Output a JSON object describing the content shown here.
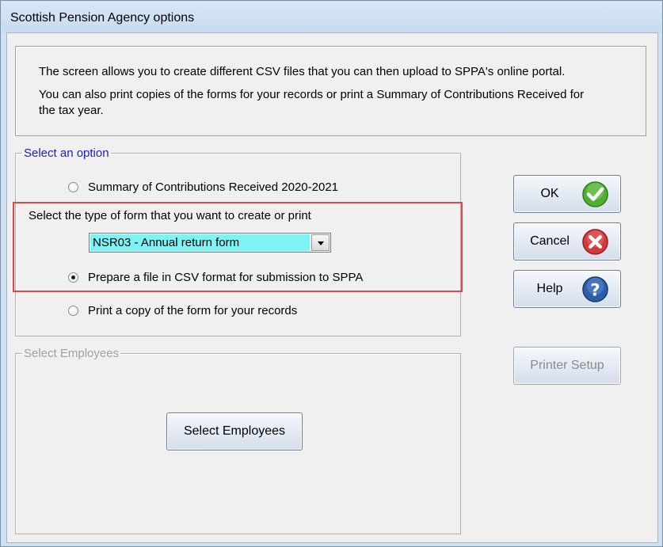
{
  "window": {
    "title": "Scottish Pension Agency options"
  },
  "info": {
    "line1": "The screen allows you to create different CSV files that you can then upload to SPPA's online portal.",
    "line2": "You can also print copies of the forms for your records or print a Summary of Contributions Received for",
    "line3": "the tax year."
  },
  "options_group": {
    "legend": "Select an option",
    "radio_summary": "Summary of Contributions Received 2020-2021",
    "form_type_label": "Select the type of form that you want to create or print",
    "form_type_value": "NSR03 - Annual return form",
    "radio_csv": "Prepare a file in CSV format for submission to SPPA",
    "radio_print": "Print a copy of the form for your records",
    "selected": "csv"
  },
  "employees_group": {
    "legend": "Select Employees",
    "button": "Select Employees"
  },
  "buttons": {
    "ok": "OK",
    "cancel": "Cancel",
    "help": "Help",
    "printer_setup": "Printer Setup"
  },
  "icons": {
    "ok": "check-icon",
    "cancel": "x-icon",
    "help": "question-icon"
  },
  "colors": {
    "highlight": "#e0474c",
    "legend_active": "#1a1ad8",
    "select_highlight": "#7ef3f6"
  }
}
